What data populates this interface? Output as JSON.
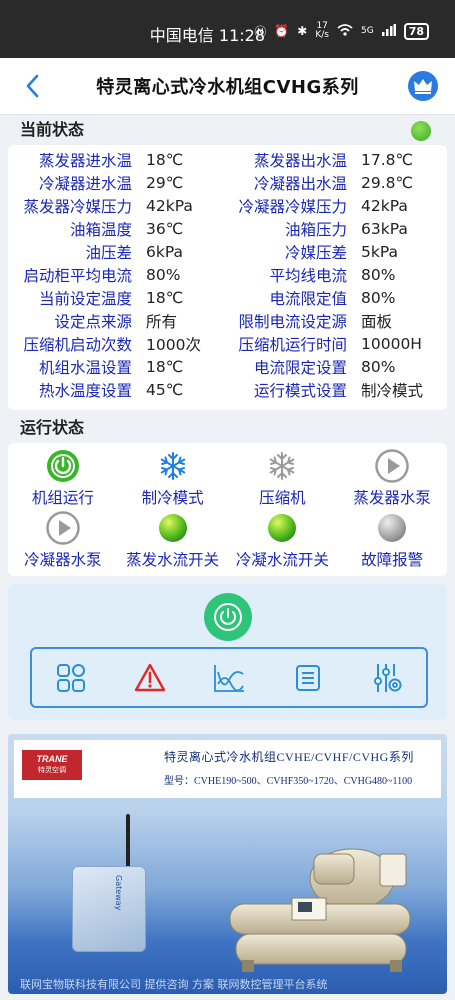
{
  "statusbar": {
    "carrier_time": "中国电信 11:28",
    "net_speed": "17\nK/s",
    "network": "5G",
    "battery": "78"
  },
  "header": {
    "title": "特灵离心式冷水机组CVHG系列"
  },
  "current_status": {
    "heading": "当前状态",
    "indicator_color": "#3aad1d",
    "rows": [
      {
        "l1": "蒸发器进水温",
        "v1": "18℃",
        "l2": "蒸发器出水温",
        "v2": "17.8℃"
      },
      {
        "l1": "冷凝器进水温",
        "v1": "29℃",
        "l2": "冷凝器出水温",
        "v2": "29.8℃"
      },
      {
        "l1": "蒸发器冷媒压力",
        "v1": "42kPa",
        "l2": "冷凝器冷媒压力",
        "v2": "42kPa"
      },
      {
        "l1": "油箱温度",
        "v1": "36℃",
        "l2": "油箱压力",
        "v2": "63kPa"
      },
      {
        "l1": "油压差",
        "v1": "6kPa",
        "l2": "冷媒压差",
        "v2": "5kPa"
      },
      {
        "l1": "启动柜平均电流",
        "v1": "80%",
        "l2": "平均线电流",
        "v2": "80%"
      },
      {
        "l1": "当前设定温度",
        "v1": "18℃",
        "l2": "电流限定值",
        "v2": "80%"
      },
      {
        "l1": "设定点来源",
        "v1": "所有",
        "l2": "限制电流设定源",
        "v2": "面板"
      },
      {
        "l1": "压缩机启动次数",
        "v1": "1000次",
        "l2": "压缩机运行时间",
        "v2": "10000H"
      },
      {
        "l1": "机组水温设置",
        "v1": "18℃",
        "l2": "电流限定设置",
        "v2": "80%"
      },
      {
        "l1": "热水温度设置",
        "v1": "45℃",
        "l2": "运行模式设置",
        "v2": "制冷模式"
      }
    ]
  },
  "run_status": {
    "heading": "运行状态",
    "items": [
      {
        "label": "机组运行",
        "icon": "power-icon"
      },
      {
        "label": "制冷模式",
        "icon": "snowflake-icon"
      },
      {
        "label": "压缩机",
        "icon": "snowflake-gray-icon"
      },
      {
        "label": "蒸发器水泵",
        "icon": "play-gray-icon"
      },
      {
        "label": "冷凝器水泵",
        "icon": "play-gray-icon"
      },
      {
        "label": "蒸发水流开关",
        "icon": "green-dot-icon"
      },
      {
        "label": "冷凝水流开关",
        "icon": "green-dot-icon"
      },
      {
        "label": "故障报警",
        "icon": "gray-dot-icon"
      }
    ]
  },
  "controls": {
    "power_color": "#2ec47a",
    "tools": [
      "grid-icon",
      "warning-icon",
      "chart-icon",
      "list-icon",
      "sliders-icon"
    ]
  },
  "banner": {
    "logo_text": "TRANE",
    "logo_sub": "特灵空调",
    "title": "特灵离心式冷水机组CVHE/CVHF/CVHG系列",
    "models": "型号：CVHE190~500、CVHF350~1720、CVHG480~1100",
    "gateway_label": "Gateway",
    "bottom_text": "联网宝物联科技有限公司 提供咨询 方案 联网数控管理平台系统"
  }
}
